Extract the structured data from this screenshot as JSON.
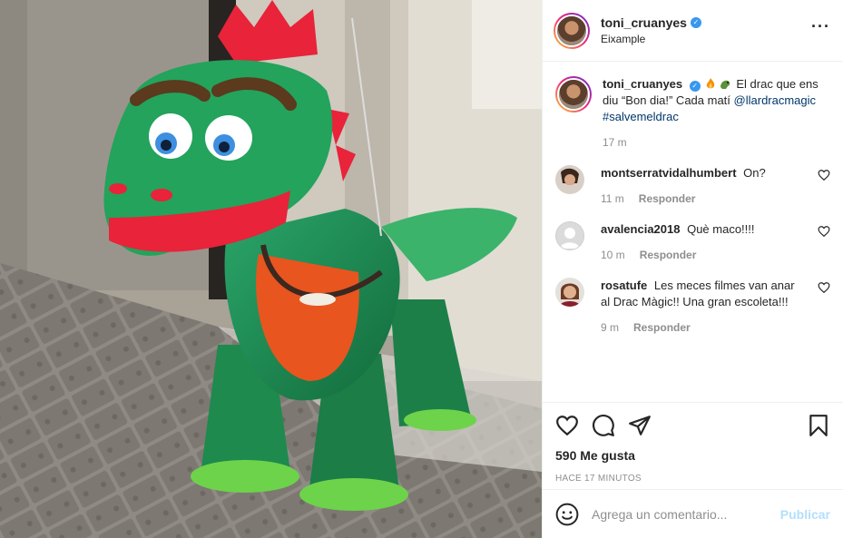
{
  "post": {
    "author": "toni_cruanyes",
    "location": "Eixample",
    "more_icon": "more-horizontal-icon"
  },
  "caption": {
    "username": "toni_cruanyes",
    "text_pre": "El drac que ens diu “Bon dia!” Cada matí",
    "mention": "@llardracmagic",
    "hashtag": "#salvemeldrac",
    "emojis": [
      "fire-emoji",
      "dragon-emoji"
    ],
    "time": "17 m"
  },
  "comments": [
    {
      "username": "montserratvidalhumbert",
      "text": "On?",
      "time": "11 m",
      "reply": "Responder"
    },
    {
      "username": "avalencia2018",
      "text": "Què maco!!!!",
      "time": "10 m",
      "reply": "Responder"
    },
    {
      "username": "rosatufe",
      "text": "Les meces filmes van anar al Drac Màgic!! Una gran escoleta!!!",
      "time": "9 m",
      "reply": "Responder"
    }
  ],
  "stats": {
    "likes": "590 Me gusta",
    "posted": "HACE 17 MINUTOS"
  },
  "composer": {
    "placeholder": "Agrega un comentario...",
    "publish": "Publicar"
  },
  "colors": {
    "verified": "#3897f0",
    "link": "#00376b",
    "publish_disabled": "#b2dffc",
    "muted": "#8e8e8e"
  }
}
